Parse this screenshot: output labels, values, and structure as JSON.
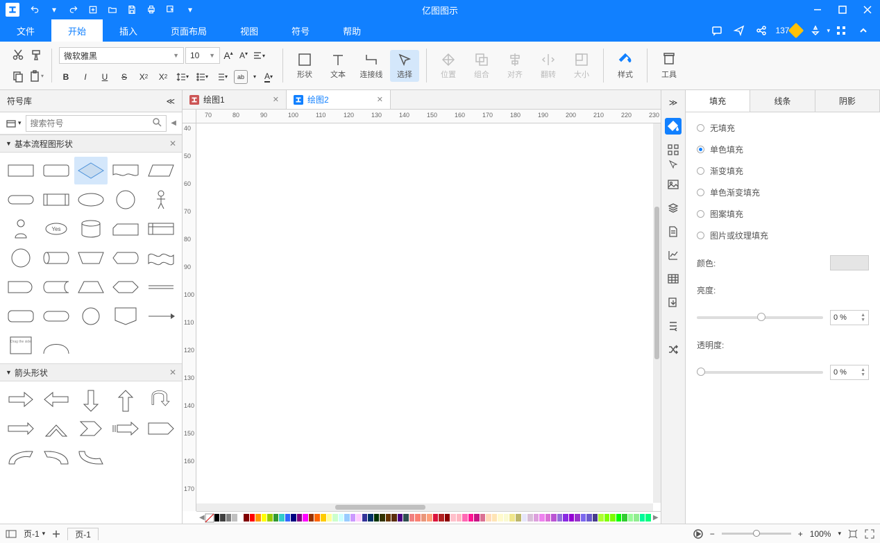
{
  "app": {
    "title": "亿图图示"
  },
  "menus": [
    "文件",
    "开始",
    "插入",
    "页面布局",
    "视图",
    "符号",
    "帮助"
  ],
  "active_menu": 1,
  "points": "137",
  "font": {
    "family": "微软雅黑",
    "size": "10"
  },
  "ribbon_tools": {
    "shape": "形状",
    "text": "文本",
    "connector": "连接线",
    "select": "选择",
    "position": "位置",
    "combine": "组合",
    "align": "对齐",
    "flip": "翻转",
    "size": "大小",
    "style": "样式",
    "tools": "工具"
  },
  "left": {
    "title": "符号库",
    "search_placeholder": "搜索符号",
    "cat1": "基本流程图形状",
    "cat2": "箭头形状"
  },
  "tabs": [
    {
      "name": "绘图1",
      "active": false
    },
    {
      "name": "绘图2",
      "active": true
    }
  ],
  "ruler_h": [
    "70",
    "80",
    "90",
    "100",
    "110",
    "120",
    "130",
    "140",
    "150",
    "160",
    "170",
    "180",
    "190",
    "200",
    "210",
    "220",
    "230"
  ],
  "ruler_v": [
    "40",
    "50",
    "60",
    "70",
    "80",
    "90",
    "100",
    "110",
    "120",
    "130",
    "140",
    "150",
    "160",
    "170"
  ],
  "right_panel": {
    "tabs": [
      "填充",
      "线条",
      "阴影"
    ],
    "active_tab": 0,
    "fill_opts": [
      "无填充",
      "单色填充",
      "渐变填充",
      "单色渐变填充",
      "图案填充",
      "图片或纹理填充"
    ],
    "selected_fill": 1,
    "labels": {
      "color": "颜色:",
      "brightness": "亮度:",
      "transparency": "透明度:"
    },
    "bright_val": "0 %",
    "trans_val": "0 %"
  },
  "status": {
    "page_sel": "页-1",
    "page_tab": "页-1",
    "zoom": "100%"
  },
  "colors": [
    "#000000",
    "#404040",
    "#808080",
    "#c0c0c0",
    "#ffffff",
    "#800000",
    "#ff0000",
    "#ff9900",
    "#ffff00",
    "#99cc00",
    "#339933",
    "#33cccc",
    "#3366ff",
    "#000080",
    "#800080",
    "#ff00ff",
    "#993300",
    "#ff6600",
    "#ffcc00",
    "#ffff99",
    "#ccffcc",
    "#ccffff",
    "#99ccff",
    "#cc99ff",
    "#ffccff",
    "#333399",
    "#003366",
    "#003300",
    "#333300",
    "#663300",
    "#5a2d0c",
    "#4b0082",
    "#2f4f4f",
    "#f08080",
    "#fa8072",
    "#e9967a",
    "#ffa07a",
    "#dc143c",
    "#b22222",
    "#8b0000",
    "#ffc0cb",
    "#ffb6c1",
    "#ff69b4",
    "#ff1493",
    "#c71585",
    "#db7093",
    "#ffdab9",
    "#ffe4b5",
    "#fffacd",
    "#fafad2",
    "#f0e68c",
    "#bdb76b",
    "#e6e6fa",
    "#d8bfd8",
    "#dda0dd",
    "#ee82ee",
    "#da70d6",
    "#ba55d3",
    "#9370db",
    "#8a2be2",
    "#9400d3",
    "#9932cc",
    "#7b68ee",
    "#6a5acd",
    "#483d8b",
    "#adff2f",
    "#7fff00",
    "#7cfc00",
    "#00ff00",
    "#32cd32",
    "#98fb98",
    "#90ee90",
    "#00fa9a",
    "#00ff7f"
  ]
}
